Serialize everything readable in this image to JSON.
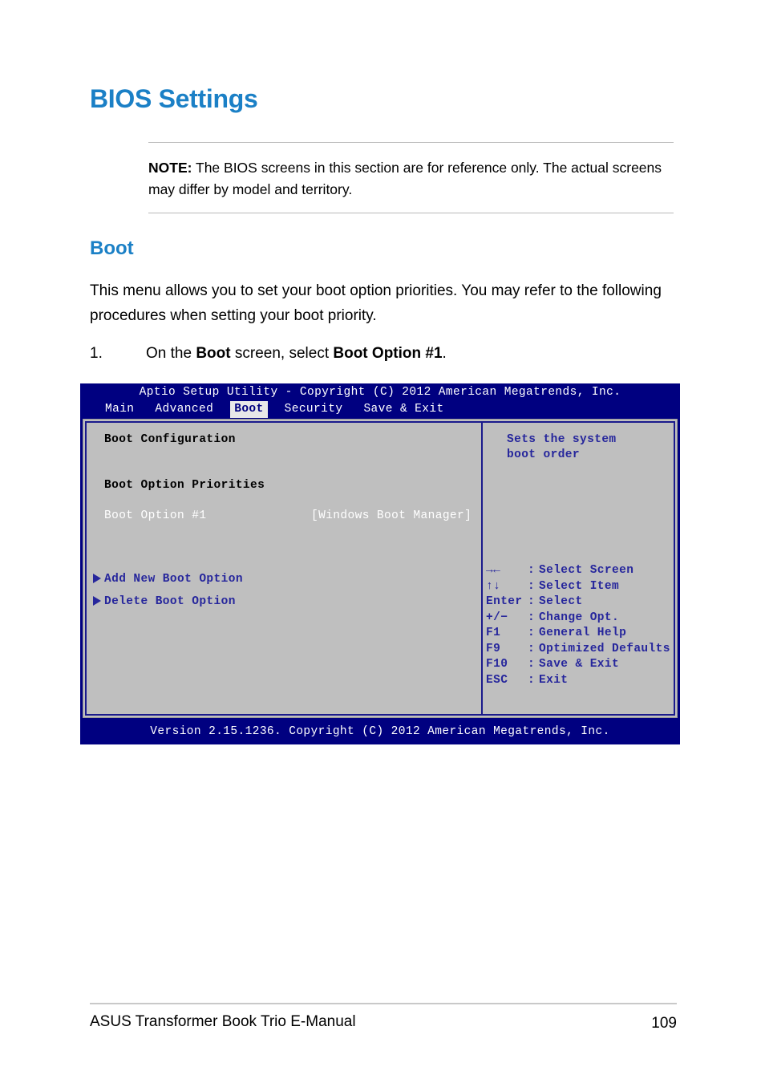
{
  "document": {
    "title": "BIOS Settings",
    "note": {
      "label": "NOTE:",
      "text": " The BIOS screens in this section are for reference only. The actual screens may differ by model and territory."
    },
    "section": {
      "heading": "Boot",
      "paragraph": "This menu allows you to set your boot option priorities. You may refer to the following procedures when setting your boot priority."
    },
    "step": {
      "number": "1.",
      "prefix": "On the ",
      "bold1": "Boot",
      "middle": " screen, select ",
      "bold2": "Boot Option #1",
      "suffix": "."
    },
    "footer": {
      "left": "ASUS Transformer Book Trio E-Manual",
      "page": "109"
    },
    "colors": {
      "heading_blue": "#1b80c6",
      "bios_navy": "#000080",
      "bios_panel_gray": "#bfbfbf",
      "bios_text_blue": "#26269c"
    }
  },
  "bios": {
    "titlebar": "Aptio Setup Utility - Copyright (C) 2012 American Megatrends, Inc.",
    "tabs": [
      {
        "label": "Main",
        "active": false
      },
      {
        "label": "Advanced",
        "active": false
      },
      {
        "label": "Boot",
        "active": true
      },
      {
        "label": "Security",
        "active": false
      },
      {
        "label": "Save & Exit",
        "active": false
      }
    ],
    "left_panel": {
      "section_title": "Boot Configuration",
      "priorities_title": "Boot Option Priorities",
      "boot_option": {
        "label": "Boot Option #1",
        "value": "[Windows Boot Manager]"
      },
      "actions": [
        {
          "label": "Add New Boot Option"
        },
        {
          "label": "Delete Boot Option"
        }
      ]
    },
    "right_panel": {
      "help_line1": "Sets the system",
      "help_line2": "boot order",
      "legend": [
        {
          "key": "→←",
          "sep": ":",
          "desc": "Select Screen"
        },
        {
          "key": "↑↓",
          "sep": ":",
          "desc": "Select Item"
        },
        {
          "key": "Enter",
          "sep": ":",
          "desc": "Select"
        },
        {
          "key": "+/−",
          "sep": ":",
          "desc": "Change Opt."
        },
        {
          "key": "F1",
          "sep": ":",
          "desc": "General Help"
        },
        {
          "key": "F9",
          "sep": ":",
          "desc": "Optimized Defaults"
        },
        {
          "key": "F10",
          "sep": ":",
          "desc": "Save & Exit"
        },
        {
          "key": "ESC",
          "sep": ":",
          "desc": "Exit"
        }
      ]
    },
    "footer": "Version 2.15.1236. Copyright (C) 2012 American Megatrends, Inc."
  }
}
